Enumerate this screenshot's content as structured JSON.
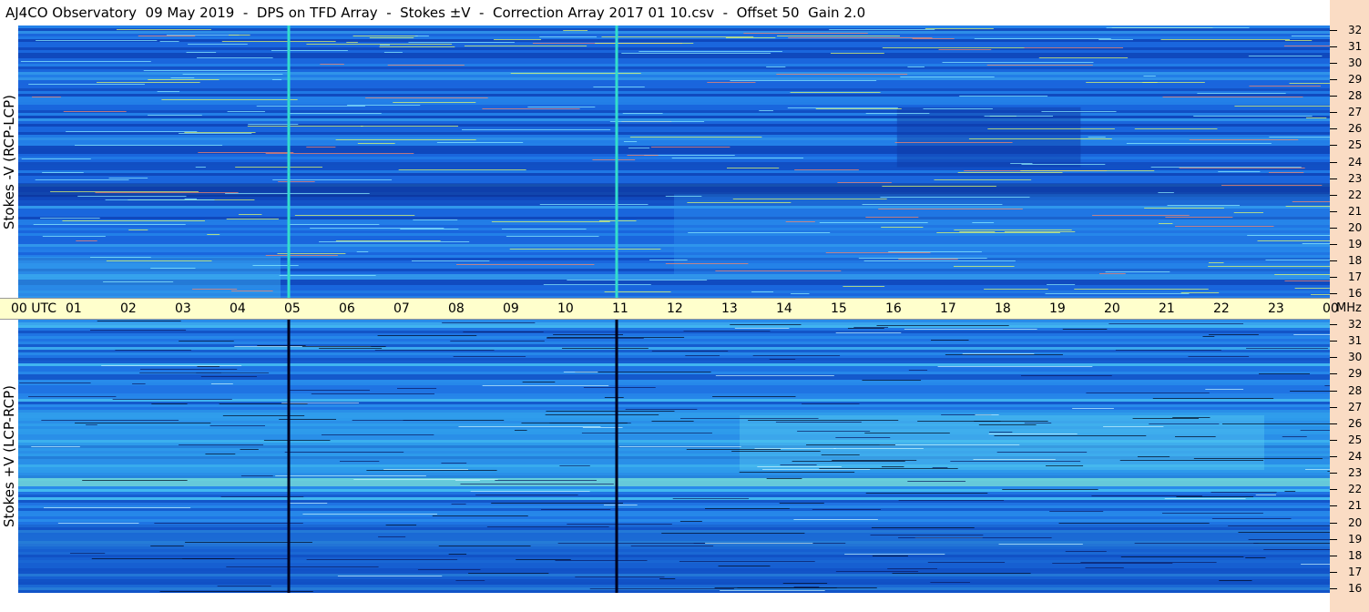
{
  "title": "AJ4CO Observatory  09 May 2019  -  DPS on TFD Array  -  Stokes ±V  -  Correction Array 2017 01 10.csv  -  Offset 50  Gain 2.0",
  "colors": {
    "background": "#ffffff",
    "time_axis_bg": "#ffffcc",
    "freq_strip_bg": "#fadcc4",
    "spectrogram_base": "#1a6fe0"
  },
  "chart_data": [
    {
      "type": "heatmap",
      "name": "Stokes -V (RCP-LCP)",
      "ylabel": "Stokes -V  (RCP-LCP)",
      "x_unit": "UTC",
      "y_unit": "MHz",
      "x_range": [
        0,
        24
      ],
      "y_range": [
        16,
        32
      ],
      "y_ticks": [
        32,
        31,
        30,
        29,
        28,
        27,
        26,
        25,
        24,
        23,
        22,
        21,
        20,
        19,
        18,
        17,
        16
      ],
      "vertical_lines_utc": [
        4.95,
        10.95
      ],
      "vertical_line_color": "#33ddcc"
    },
    {
      "type": "heatmap",
      "name": "Stokes +V (LCP-RCP)",
      "ylabel": "Stokes +V  (LCP-RCP)",
      "x_unit": "UTC",
      "y_unit": "MHz",
      "x_range": [
        0,
        24
      ],
      "y_range": [
        16,
        32
      ],
      "y_ticks": [
        32,
        31,
        30,
        29,
        28,
        27,
        26,
        25,
        24,
        23,
        22,
        21,
        20,
        19,
        18,
        17,
        16
      ],
      "vertical_lines_utc": [
        4.95,
        10.95
      ],
      "vertical_line_color": "#000020"
    }
  ],
  "time_axis": {
    "ticks": [
      "00",
      "01",
      "02",
      "03",
      "04",
      "05",
      "06",
      "07",
      "08",
      "09",
      "10",
      "11",
      "12",
      "13",
      "14",
      "15",
      "16",
      "17",
      "18",
      "19",
      "20",
      "21",
      "22",
      "23",
      "00"
    ],
    "first_label": "UTC",
    "unit": "MHz"
  }
}
